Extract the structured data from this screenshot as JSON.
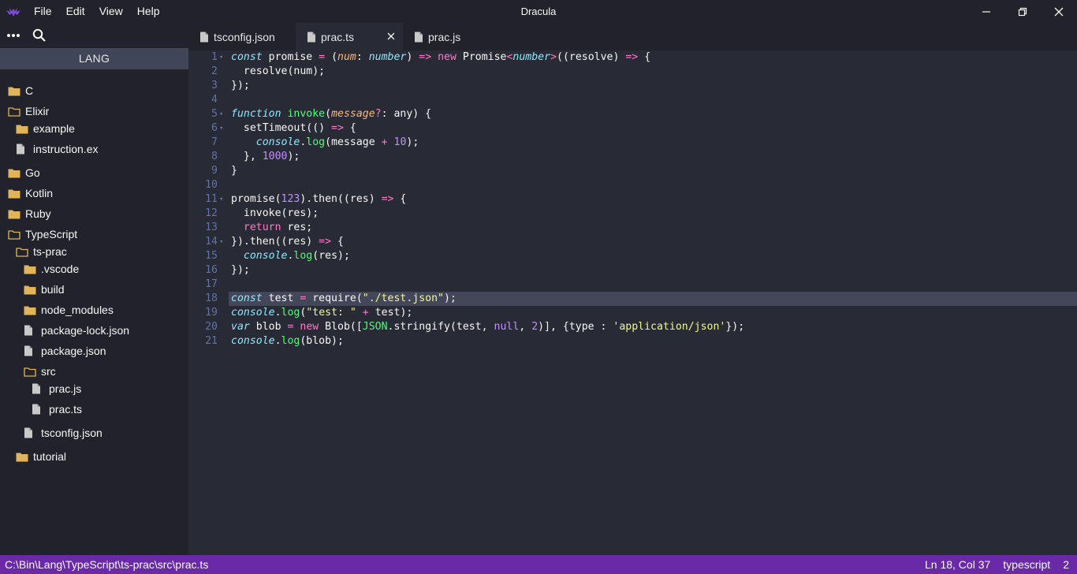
{
  "window": {
    "title": "Dracula",
    "menu": [
      "File",
      "Edit",
      "View",
      "Help"
    ]
  },
  "sidebar": {
    "header": "LANG",
    "items": [
      {
        "label": "C",
        "type": "folder",
        "open": false,
        "depth": 0
      },
      {
        "label": "Elixir",
        "type": "folder",
        "open": true,
        "depth": 0
      },
      {
        "label": "example",
        "type": "folder",
        "open": false,
        "depth": 1
      },
      {
        "label": "instruction.ex",
        "type": "file",
        "depth": 1
      },
      {
        "label": "Go",
        "type": "folder",
        "open": false,
        "depth": 0
      },
      {
        "label": "Kotlin",
        "type": "folder",
        "open": false,
        "depth": 0
      },
      {
        "label": "Ruby",
        "type": "folder",
        "open": false,
        "depth": 0
      },
      {
        "label": "TypeScript",
        "type": "folder",
        "open": true,
        "depth": 0
      },
      {
        "label": "ts-prac",
        "type": "folder",
        "open": true,
        "depth": 1
      },
      {
        "label": ".vscode",
        "type": "folder",
        "open": false,
        "depth": 2
      },
      {
        "label": "build",
        "type": "folder",
        "open": false,
        "depth": 2
      },
      {
        "label": "node_modules",
        "type": "folder",
        "open": false,
        "depth": 2
      },
      {
        "label": "package-lock.json",
        "type": "file",
        "depth": 2
      },
      {
        "label": "package.json",
        "type": "file",
        "depth": 2
      },
      {
        "label": "src",
        "type": "folder",
        "open": true,
        "depth": 2
      },
      {
        "label": "prac.js",
        "type": "file",
        "depth": 3
      },
      {
        "label": "prac.ts",
        "type": "file",
        "depth": 3
      },
      {
        "label": "tsconfig.json",
        "type": "file",
        "depth": 2
      },
      {
        "label": "tutorial",
        "type": "folder",
        "open": false,
        "depth": 1
      }
    ]
  },
  "tabs": [
    {
      "label": "tsconfig.json",
      "active": false
    },
    {
      "label": "prac.ts",
      "active": true
    },
    {
      "label": "prac.js",
      "active": false
    }
  ],
  "editor": {
    "current_line": 18,
    "lines": [
      {
        "n": "1",
        "fold": true,
        "tokens": [
          [
            "ki",
            "const"
          ],
          [
            "c",
            " promise "
          ],
          [
            "k",
            "="
          ],
          [
            "c",
            " ("
          ],
          [
            "p",
            "num"
          ],
          [
            "c",
            ": "
          ],
          [
            "t",
            "number"
          ],
          [
            "c",
            ") "
          ],
          [
            "k",
            "=>"
          ],
          [
            "c",
            " "
          ],
          [
            "k",
            "new"
          ],
          [
            "c",
            " Promise"
          ],
          [
            "k",
            "<"
          ],
          [
            "t",
            "number"
          ],
          [
            "k",
            ">"
          ],
          [
            "c",
            "((resolve) "
          ],
          [
            "k",
            "=>"
          ],
          [
            "c",
            " {"
          ]
        ]
      },
      {
        "n": "2",
        "fold": false,
        "tokens": [
          [
            "c",
            "  resolve(num);"
          ]
        ]
      },
      {
        "n": "3",
        "fold": false,
        "tokens": [
          [
            "c",
            "});"
          ]
        ]
      },
      {
        "n": "4",
        "fold": false,
        "tokens": []
      },
      {
        "n": "5",
        "fold": true,
        "tokens": [
          [
            "ki",
            "function"
          ],
          [
            "c",
            " "
          ],
          [
            "f",
            "invoke"
          ],
          [
            "c",
            "("
          ],
          [
            "p",
            "message"
          ],
          [
            "k",
            "?"
          ],
          [
            "c",
            ": any) {"
          ]
        ]
      },
      {
        "n": "6",
        "fold": true,
        "tokens": [
          [
            "c",
            "  setTimeout(() "
          ],
          [
            "k",
            "=>"
          ],
          [
            "c",
            " {"
          ]
        ]
      },
      {
        "n": "7",
        "fold": false,
        "tokens": [
          [
            "c",
            "    "
          ],
          [
            "t",
            "console"
          ],
          [
            "c",
            "."
          ],
          [
            "cls",
            "log"
          ],
          [
            "c",
            "(message "
          ],
          [
            "k",
            "+"
          ],
          [
            "c",
            " "
          ],
          [
            "n",
            "10"
          ],
          [
            "c",
            ");"
          ]
        ]
      },
      {
        "n": "8",
        "fold": false,
        "tokens": [
          [
            "c",
            "  }, "
          ],
          [
            "n",
            "1000"
          ],
          [
            "c",
            ");"
          ]
        ]
      },
      {
        "n": "9",
        "fold": false,
        "tokens": [
          [
            "c",
            "}"
          ]
        ]
      },
      {
        "n": "10",
        "fold": false,
        "tokens": []
      },
      {
        "n": "11",
        "fold": true,
        "tokens": [
          [
            "c",
            "promise("
          ],
          [
            "n",
            "123"
          ],
          [
            "c",
            ").then((res) "
          ],
          [
            "k",
            "=>"
          ],
          [
            "c",
            " {"
          ]
        ]
      },
      {
        "n": "12",
        "fold": false,
        "tokens": [
          [
            "c",
            "  invoke(res);"
          ]
        ]
      },
      {
        "n": "13",
        "fold": false,
        "tokens": [
          [
            "c",
            "  "
          ],
          [
            "k",
            "return"
          ],
          [
            "c",
            " res;"
          ]
        ]
      },
      {
        "n": "14",
        "fold": true,
        "tokens": [
          [
            "c",
            "}).then((res) "
          ],
          [
            "k",
            "=>"
          ],
          [
            "c",
            " {"
          ]
        ]
      },
      {
        "n": "15",
        "fold": false,
        "tokens": [
          [
            "c",
            "  "
          ],
          [
            "t",
            "console"
          ],
          [
            "c",
            "."
          ],
          [
            "cls",
            "log"
          ],
          [
            "c",
            "(res);"
          ]
        ]
      },
      {
        "n": "16",
        "fold": false,
        "tokens": [
          [
            "c",
            "});"
          ]
        ]
      },
      {
        "n": "17",
        "fold": false,
        "tokens": []
      },
      {
        "n": "18",
        "fold": false,
        "tokens": [
          [
            "ki",
            "const"
          ],
          [
            "c",
            " test "
          ],
          [
            "k",
            "="
          ],
          [
            "c",
            " require("
          ],
          [
            "s",
            "\"./test.json\""
          ],
          [
            "c",
            ");"
          ]
        ]
      },
      {
        "n": "19",
        "fold": false,
        "tokens": [
          [
            "t",
            "console"
          ],
          [
            "c",
            "."
          ],
          [
            "cls",
            "log"
          ],
          [
            "c",
            "("
          ],
          [
            "s",
            "\"test: \""
          ],
          [
            "c",
            " "
          ],
          [
            "k",
            "+"
          ],
          [
            "c",
            " test);"
          ]
        ]
      },
      {
        "n": "20",
        "fold": false,
        "tokens": [
          [
            "ki",
            "var"
          ],
          [
            "c",
            " blob "
          ],
          [
            "k",
            "="
          ],
          [
            "c",
            " "
          ],
          [
            "k",
            "new"
          ],
          [
            "c",
            " Blob(["
          ],
          [
            "cls",
            "JSON"
          ],
          [
            "c",
            ".stringify(test, "
          ],
          [
            "n",
            "null"
          ],
          [
            "c",
            ", "
          ],
          [
            "n",
            "2"
          ],
          [
            "c",
            ")], {type : "
          ],
          [
            "s",
            "'application/json'"
          ],
          [
            "c",
            "});"
          ]
        ]
      },
      {
        "n": "21",
        "fold": false,
        "tokens": [
          [
            "t",
            "console"
          ],
          [
            "c",
            "."
          ],
          [
            "cls",
            "log"
          ],
          [
            "c",
            "(blob);"
          ]
        ]
      }
    ]
  },
  "status": {
    "path": "C:\\Bin\\Lang\\TypeScript\\ts-prac\\src\\prac.ts",
    "cursor": "Ln 18, Col 37",
    "language": "typescript",
    "indent": "2"
  },
  "colors": {
    "background": "#282a36",
    "sidebar": "#21222c",
    "statusbar": "#6a2aa8",
    "folder": "#e0b45a"
  }
}
